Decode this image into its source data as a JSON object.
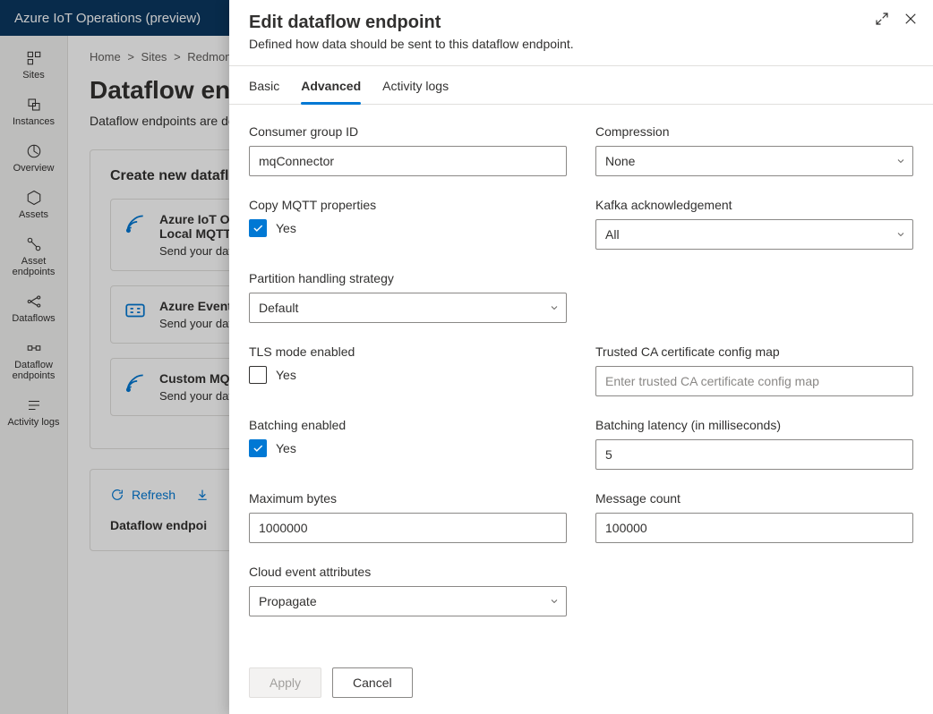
{
  "topbar": {
    "title": "Azure IoT Operations (preview)"
  },
  "sidebar": {
    "items": [
      {
        "label": "Sites"
      },
      {
        "label": "Instances"
      },
      {
        "label": "Overview"
      },
      {
        "label": "Assets"
      },
      {
        "label": "Asset endpoints"
      },
      {
        "label": "Dataflows"
      },
      {
        "label": "Dataflow endpoints"
      },
      {
        "label": "Activity logs"
      }
    ]
  },
  "breadcrumb": {
    "items": [
      "Home",
      "Sites",
      "Redmond"
    ],
    "sep": ">"
  },
  "page": {
    "title_visible": "Dataflow end",
    "subtitle_visible": "Dataflow endpoints are de",
    "create_heading_visible": "Create new datafl"
  },
  "tiles": {
    "mqtt": {
      "title_line1_visible": "Azure IoT Op",
      "title_line2": "Local MQTT",
      "desc_visible": "Send your data here to topic and payload form"
    },
    "eventhub": {
      "title_visible": "Azure Event",
      "desc_visible": "Send your data to Azu time analytics"
    },
    "custom": {
      "title_visible": "Custom MQT",
      "desc_visible": "Send your data to a cu payload format"
    }
  },
  "toolbar": {
    "refresh": "Refresh",
    "download_partial": ""
  },
  "table": {
    "head_visible": "Dataflow endpoi"
  },
  "flyout": {
    "title": "Edit dataflow endpoint",
    "subtitle": "Defined how data should be sent to this dataflow endpoint.",
    "tabs": {
      "basic": "Basic",
      "advanced": "Advanced",
      "activity": "Activity logs"
    },
    "fields": {
      "consumer_group_id": {
        "label": "Consumer group ID",
        "value": "mqConnector"
      },
      "compression": {
        "label": "Compression",
        "value": "None"
      },
      "copy_mqtt": {
        "label": "Copy MQTT properties",
        "checkbox_label": "Yes",
        "checked": true
      },
      "kafka_ack": {
        "label": "Kafka acknowledgement",
        "value": "All"
      },
      "partition_strategy": {
        "label": "Partition handling strategy",
        "value": "Default"
      },
      "tls_mode": {
        "label": "TLS mode enabled",
        "checkbox_label": "Yes",
        "checked": false
      },
      "trusted_ca": {
        "label": "Trusted CA certificate config map",
        "placeholder": "Enter trusted CA certificate config map",
        "value": ""
      },
      "batching_enabled": {
        "label": "Batching enabled",
        "checkbox_label": "Yes",
        "checked": true
      },
      "batching_latency": {
        "label": "Batching latency (in milliseconds)",
        "value": "5"
      },
      "max_bytes": {
        "label": "Maximum bytes",
        "value": "1000000"
      },
      "message_count": {
        "label": "Message count",
        "value": "100000"
      },
      "cloud_event_attrs": {
        "label": "Cloud event attributes",
        "value": "Propagate"
      }
    },
    "footer": {
      "apply": "Apply",
      "cancel": "Cancel"
    }
  }
}
